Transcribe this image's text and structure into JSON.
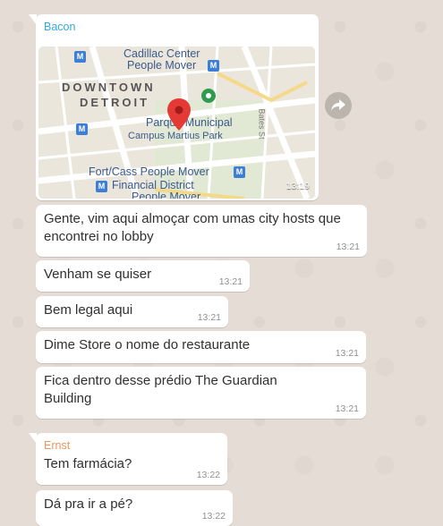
{
  "first_group": {
    "sender": "Bacon",
    "sender_color": "#35a9dd",
    "map": {
      "labels": {
        "cadillac": "Cadillac Center",
        "people_mover": "People Mover",
        "downtown": "DOWNTOWN",
        "detroit": "DETROIT",
        "parque": "Parque Municipal",
        "campus": "Campus Martius Park",
        "bates": "Bates St",
        "fort_cass": "Fort/Cass People Mover",
        "financial": "Financial District",
        "people_mover_bottom": "People Mover"
      },
      "time": "13:19"
    },
    "messages": [
      {
        "text": "Gente, vim aqui almoçar com umas city hosts que encontrei no lobby",
        "time": "13:21"
      },
      {
        "text": "Venham se quiser",
        "time": "13:21"
      },
      {
        "text": "Bem legal aqui",
        "time": "13:21"
      },
      {
        "text": "Dime Store o nome do restaurante",
        "time": "13:21"
      },
      {
        "text": "Fica dentro desse prédio The Guardian Building",
        "time": "13:21"
      }
    ]
  },
  "second_group": {
    "sender": "Ernst",
    "sender_color": "#e8985e",
    "messages": [
      {
        "text": "Tem farmácia?",
        "time": "13:22"
      },
      {
        "text": "Dá pra ir a pé?",
        "time": "13:22"
      }
    ]
  },
  "icons": {
    "forward": "forward-arrow-icon",
    "map_pin": "map-pin-icon",
    "metro": "metro-station-icon"
  }
}
